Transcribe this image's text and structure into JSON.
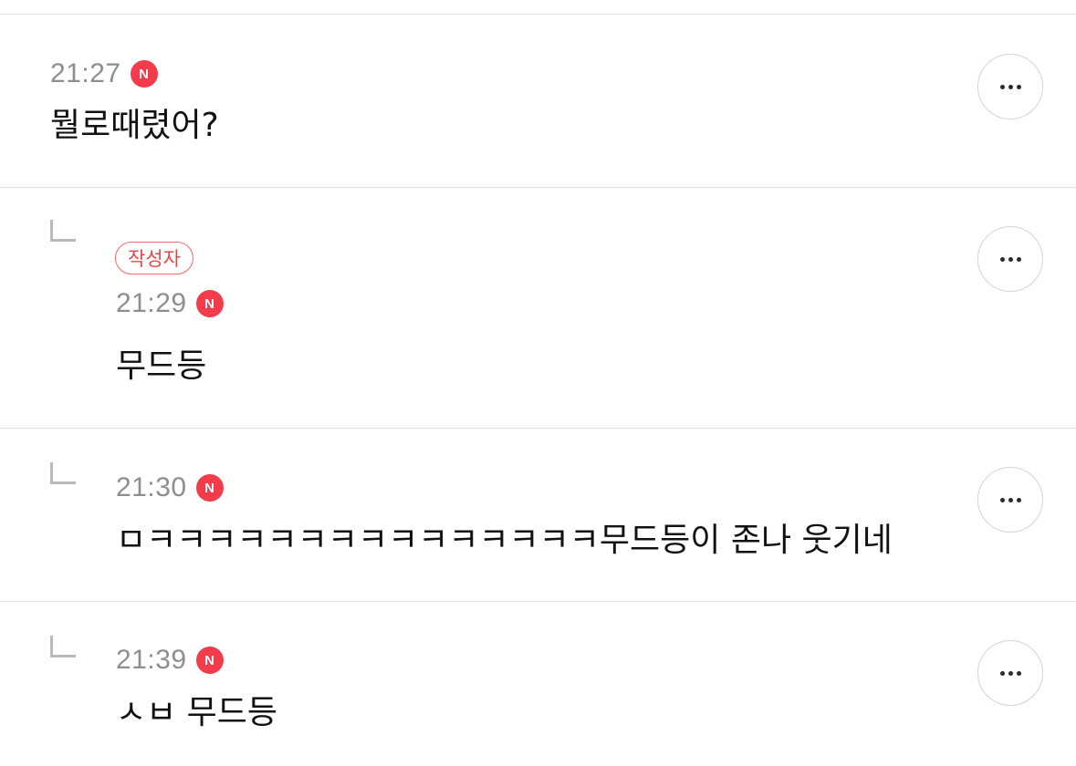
{
  "comments": [
    {
      "time": "21:27",
      "new_badge": "N",
      "text": "뭘로때렸어?",
      "is_reply": false,
      "author_badge": null
    },
    {
      "time": "21:29",
      "new_badge": "N",
      "text": "무드등",
      "is_reply": true,
      "author_badge": "작성자"
    },
    {
      "time": "21:30",
      "new_badge": "N",
      "text": "ㅁㅋㅋㅋㅋㅋㅋㅋㅋㅋㅋㅋㅋㅋㅋㅋ무드등이 존나 웃기네",
      "is_reply": true,
      "author_badge": null
    },
    {
      "time": "21:39",
      "new_badge": "N",
      "text": "ㅅㅂ 무드등",
      "is_reply": true,
      "author_badge": null
    }
  ],
  "icons": {
    "more": "more-horizontal-icon",
    "reply": "reply-corner-icon"
  },
  "colors": {
    "new_badge": "#f23c4b",
    "author_badge": "#e94747",
    "time": "#8e8e8e",
    "divider": "#e2e2e2"
  }
}
